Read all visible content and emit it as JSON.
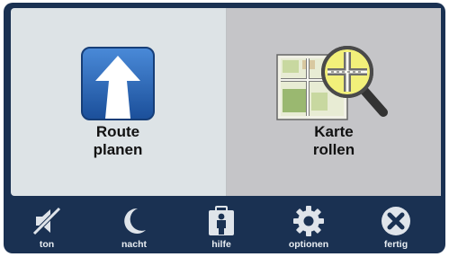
{
  "main": {
    "tiles": [
      {
        "label": "Route\nplanen",
        "icon": "route-arrow-icon"
      },
      {
        "label": "Karte\nrollen",
        "icon": "map-magnifier-icon"
      }
    ]
  },
  "toolbar": {
    "items": [
      {
        "label": "ton",
        "icon": "mute-speaker-icon"
      },
      {
        "label": "nacht",
        "icon": "moon-icon"
      },
      {
        "label": "hilfe",
        "icon": "help-person-icon"
      },
      {
        "label": "optionen",
        "icon": "gear-icon"
      },
      {
        "label": "fertig",
        "icon": "close-icon"
      }
    ]
  },
  "colors": {
    "toolbar_bg": "#1a3152",
    "panel_bg": "#dde3e6",
    "selected_tile_bg": "#c5c5c8",
    "route_icon_blue": "#2a66b8"
  }
}
